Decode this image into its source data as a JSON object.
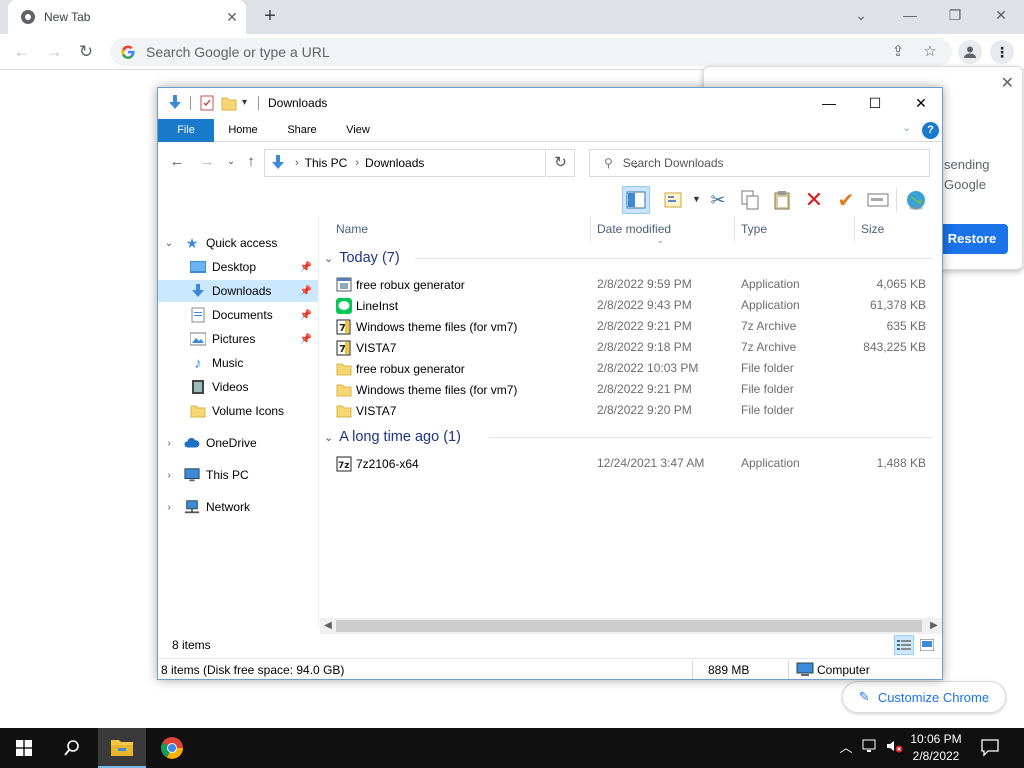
{
  "chrome": {
    "tab_title": "New Tab",
    "omnibox_placeholder": "Search Google or type a URL",
    "popup": {
      "text_line1": "sending",
      "text_line2": "Google",
      "restore_label": "Restore"
    },
    "customize_label": "Customize Chrome"
  },
  "explorer": {
    "title": "Downloads",
    "ribbon_tabs": [
      "File",
      "Home",
      "Share",
      "View"
    ],
    "breadcrumb": [
      "This PC",
      "Downloads"
    ],
    "search_placeholder": "Search Downloads",
    "columns": [
      "Name",
      "Date modified",
      "Type",
      "Size"
    ],
    "nav": {
      "quick_access": "Quick access",
      "items": [
        {
          "label": "Desktop",
          "pinned": true
        },
        {
          "label": "Downloads",
          "pinned": true,
          "selected": true
        },
        {
          "label": "Documents",
          "pinned": true
        },
        {
          "label": "Pictures",
          "pinned": true
        },
        {
          "label": "Music",
          "pinned": false
        },
        {
          "label": "Videos",
          "pinned": false
        },
        {
          "label": "Volume Icons",
          "pinned": false
        }
      ],
      "onedrive": "OneDrive",
      "this_pc": "This PC",
      "network": "Network"
    },
    "groups": [
      {
        "label": "Today (7)",
        "files": [
          {
            "name": "free robux generator",
            "date": "2/8/2022 9:59 PM",
            "type": "Application",
            "size": "4,065 KB",
            "icon": "app-icon"
          },
          {
            "name": "LineInst",
            "date": "2/8/2022 9:43 PM",
            "type": "Application",
            "size": "61,378 KB",
            "icon": "line-app-icon"
          },
          {
            "name": "Windows theme files (for vm7)",
            "date": "2/8/2022 9:21 PM",
            "type": "7z Archive",
            "size": "635 KB",
            "icon": "7z-archive-icon"
          },
          {
            "name": "VISTA7",
            "date": "2/8/2022 9:18 PM",
            "type": "7z Archive",
            "size": "843,225 KB",
            "icon": "7z-archive-icon"
          },
          {
            "name": "free robux generator",
            "date": "2/8/2022 10:03 PM",
            "type": "File folder",
            "size": "",
            "icon": "folder-icon"
          },
          {
            "name": "Windows theme files (for vm7)",
            "date": "2/8/2022 9:21 PM",
            "type": "File folder",
            "size": "",
            "icon": "folder-icon"
          },
          {
            "name": "VISTA7",
            "date": "2/8/2022 9:20 PM",
            "type": "File folder",
            "size": "",
            "icon": "folder-icon"
          }
        ]
      },
      {
        "label": "A long time ago (1)",
        "files": [
          {
            "name": "7z2106-x64",
            "date": "12/24/2021 3:47 AM",
            "type": "Application",
            "size": "1,488 KB",
            "icon": "7zip-installer-icon"
          }
        ]
      }
    ],
    "item_count": "8 items",
    "status": {
      "left": "8 items (Disk free space: 94.0 GB)",
      "size": "889 MB",
      "location": "Computer"
    }
  },
  "taskbar": {
    "time": "10:06 PM",
    "date": "2/8/2022"
  }
}
